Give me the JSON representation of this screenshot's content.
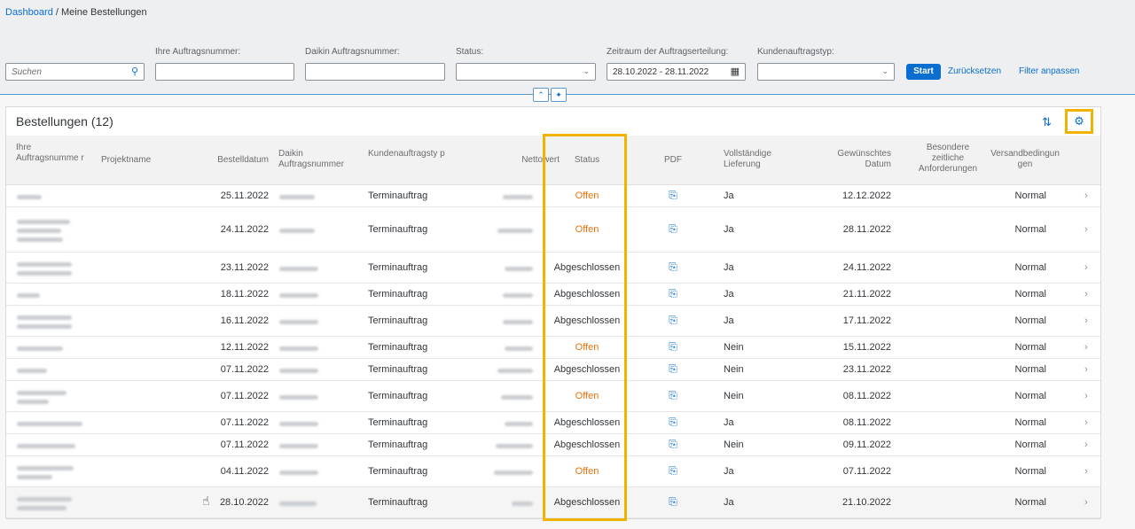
{
  "breadcrumb": {
    "root": "Dashboard",
    "separator": "/",
    "current": "Meine Bestellungen"
  },
  "filters": {
    "search_placeholder": "Suchen",
    "ihre_label": "Ihre Auftragsnummer:",
    "daikin_label": "Daikin Auftragsnummer:",
    "status_label": "Status:",
    "zeitraum_label": "Zeitraum der Auftragserteilung:",
    "zeitraum_value": "28.10.2022 - 28.11.2022",
    "kundentyp_label": "Kundenauftragstyp:",
    "start": "Start",
    "reset": "Zurücksetzen",
    "adapt": "Filter anpassen"
  },
  "table": {
    "title": "Bestellungen (12)",
    "headers": {
      "ihre": "Ihre Auftragsnumme r",
      "projekt": "Projektname",
      "bestelldatum": "Bestelldatum",
      "daikin": "Daikin Auftragsnummer",
      "kundentyp": "Kundenauftragsty p",
      "netto": "Nettowert",
      "status": "Status",
      "pdf": "PDF",
      "voll": "Vollständige Lieferung",
      "gewuenscht": "Gewünschtes Datum",
      "besondere": "Besondere zeitliche Anforderungen",
      "versand": "Versandbedingun gen"
    },
    "rows": [
      {
        "bestelldatum": "25.11.2022",
        "typ": "Terminauftrag",
        "status": "Offen",
        "voll": "Ja",
        "datum": "12.12.2022",
        "versand": "Normal"
      },
      {
        "bestelldatum": "24.11.2022",
        "typ": "Terminauftrag",
        "status": "Offen",
        "voll": "Ja",
        "datum": "28.11.2022",
        "versand": "Normal"
      },
      {
        "bestelldatum": "23.11.2022",
        "typ": "Terminauftrag",
        "status": "Abgeschlossen",
        "voll": "Ja",
        "datum": "24.11.2022",
        "versand": "Normal"
      },
      {
        "bestelldatum": "18.11.2022",
        "typ": "Terminauftrag",
        "status": "Abgeschlossen",
        "voll": "Ja",
        "datum": "21.11.2022",
        "versand": "Normal"
      },
      {
        "bestelldatum": "16.11.2022",
        "typ": "Terminauftrag",
        "status": "Abgeschlossen",
        "voll": "Ja",
        "datum": "17.11.2022",
        "versand": "Normal"
      },
      {
        "bestelldatum": "12.11.2022",
        "typ": "Terminauftrag",
        "status": "Offen",
        "voll": "Nein",
        "datum": "15.11.2022",
        "versand": "Normal"
      },
      {
        "bestelldatum": "07.11.2022",
        "typ": "Terminauftrag",
        "status": "Abgeschlossen",
        "voll": "Nein",
        "datum": "23.11.2022",
        "versand": "Normal"
      },
      {
        "bestelldatum": "07.11.2022",
        "typ": "Terminauftrag",
        "status": "Offen",
        "voll": "Nein",
        "datum": "08.11.2022",
        "versand": "Normal"
      },
      {
        "bestelldatum": "07.11.2022",
        "typ": "Terminauftrag",
        "status": "Abgeschlossen",
        "voll": "Ja",
        "datum": "08.11.2022",
        "versand": "Normal"
      },
      {
        "bestelldatum": "07.11.2022",
        "typ": "Terminauftrag",
        "status": "Abgeschlossen",
        "voll": "Nein",
        "datum": "09.11.2022",
        "versand": "Normal"
      },
      {
        "bestelldatum": "04.11.2022",
        "typ": "Terminauftrag",
        "status": "Offen",
        "voll": "Ja",
        "datum": "07.11.2022",
        "versand": "Normal"
      },
      {
        "bestelldatum": "28.10.2022",
        "typ": "Terminauftrag",
        "status": "Abgeschlossen",
        "voll": "Ja",
        "datum": "21.10.2022",
        "versand": "Normal"
      }
    ]
  },
  "icons": {
    "search": "search-icon",
    "calendar": "calendar-icon",
    "settings": "gear-icon",
    "sort": "sort-icon",
    "pdf": "pdf-icon"
  },
  "colors": {
    "accent": "#0a6ed1",
    "status_open": "#e9730c",
    "highlight": "#f0b400"
  }
}
